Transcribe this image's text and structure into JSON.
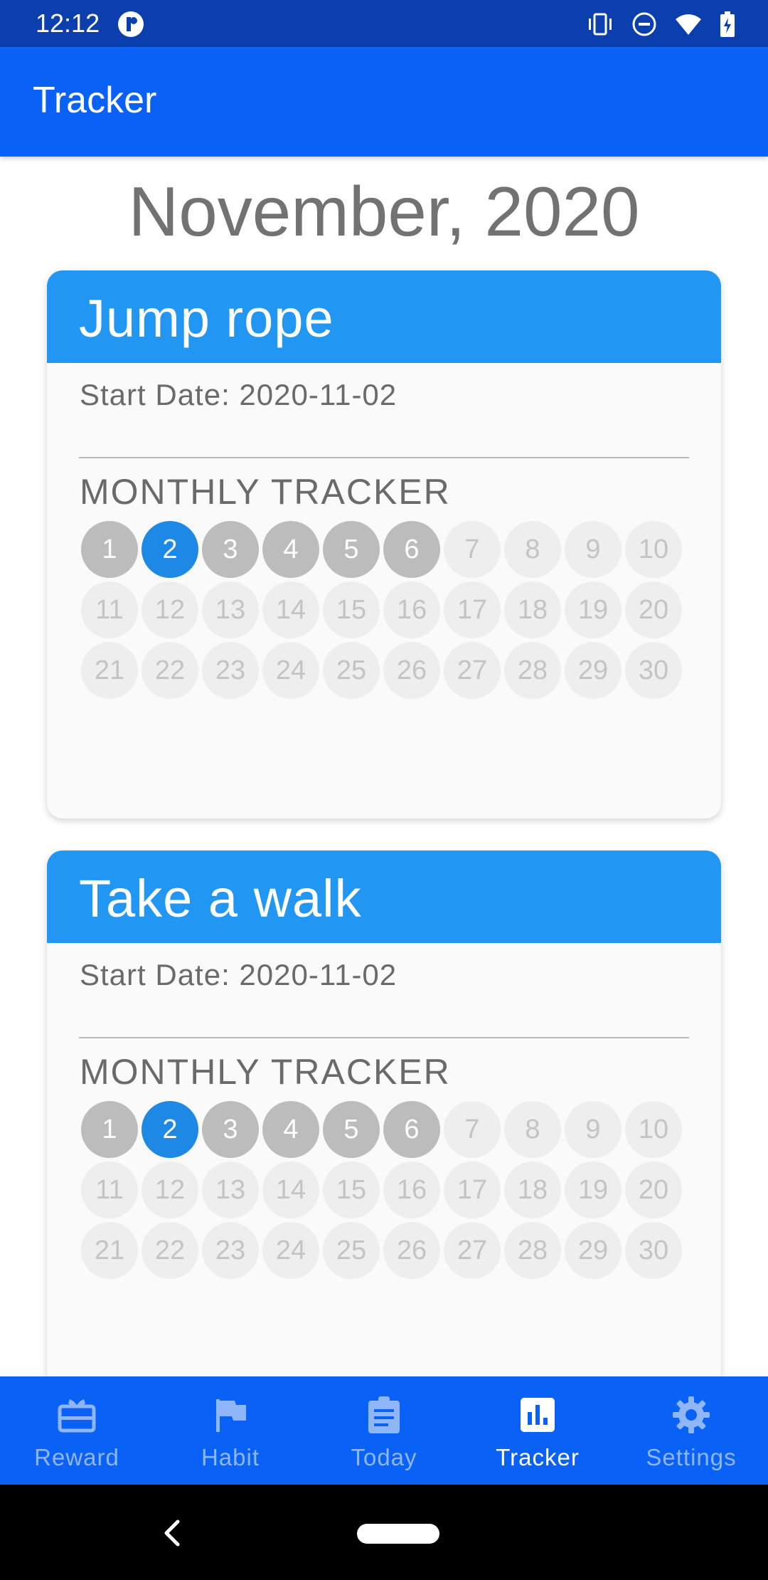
{
  "status_bar": {
    "time": "12:12",
    "icons": [
      "app-notification-icon",
      "vibrate-icon",
      "do-not-disturb-icon",
      "wifi-icon",
      "battery-charging-icon"
    ]
  },
  "app_bar": {
    "title": "Tracker"
  },
  "month_title": "November, 2020",
  "habits": [
    {
      "title": "Jump rope",
      "start_date": "Start Date: 2020-11-02",
      "tracker_label": "MONTHLY TRACKER"
    },
    {
      "title": "Take a walk",
      "start_date": "Start Date: 2020-11-02",
      "tracker_label": "MONTHLY TRACKER"
    }
  ],
  "calendar": {
    "days": [
      "1",
      "2",
      "3",
      "4",
      "5",
      "6",
      "7",
      "8",
      "9",
      "10",
      "11",
      "12",
      "13",
      "14",
      "15",
      "16",
      "17",
      "18",
      "19",
      "20",
      "21",
      "22",
      "23",
      "24",
      "25",
      "26",
      "27",
      "28",
      "29",
      "30"
    ],
    "completed_days": [
      1,
      3,
      4,
      5,
      6
    ],
    "today": 2
  },
  "bottom_nav": {
    "items": [
      {
        "label": "Reward",
        "icon": "gift-card-icon",
        "active": false
      },
      {
        "label": "Habit",
        "icon": "flag-icon",
        "active": false
      },
      {
        "label": "Today",
        "icon": "clipboard-icon",
        "active": false
      },
      {
        "label": "Tracker",
        "icon": "bar-chart-icon",
        "active": true
      },
      {
        "label": "Settings",
        "icon": "gear-icon",
        "active": false
      }
    ]
  },
  "colors": {
    "status_bar": "#0a3fad",
    "app_bar": "#0a61f5",
    "card_header": "#2196f3",
    "today_circle": "#1e88e5",
    "done_circle": "#bcbcbc",
    "pending_circle": "#eeeeee"
  }
}
